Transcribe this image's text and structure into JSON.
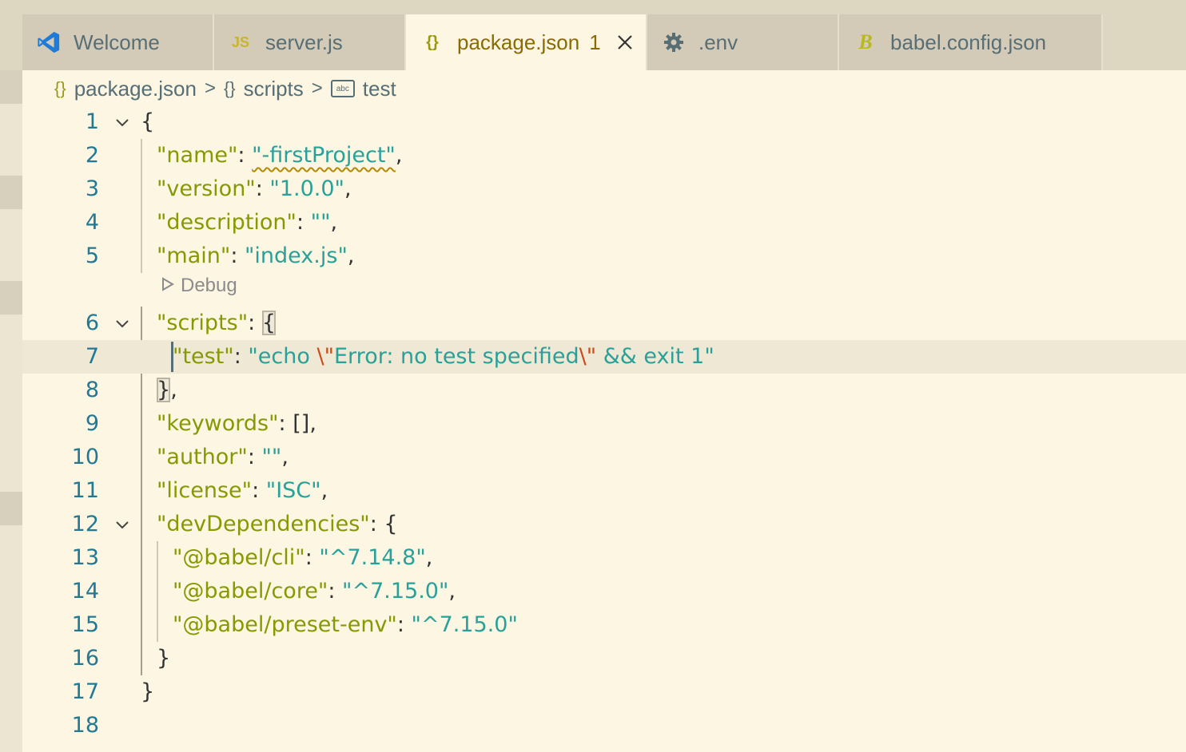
{
  "tabs": [
    {
      "label": "Welcome",
      "icon": "vscode-logo-icon",
      "active": false
    },
    {
      "label": "server.js",
      "icon": "js-file-icon",
      "icon_text": "JS",
      "active": false
    },
    {
      "label": "package.json",
      "icon": "json-braces-icon",
      "icon_text": "{}",
      "active": true,
      "problems": "1"
    },
    {
      "label": ".env",
      "icon": "gear-icon",
      "active": false
    },
    {
      "label": "babel.config.json",
      "icon": "babel-icon",
      "icon_text": "B",
      "active": false
    }
  ],
  "breadcrumb": {
    "file_icon": "{}",
    "file": "package.json",
    "sep": ">",
    "scope_icon": "{}",
    "scope": "scripts",
    "prop_icon": "abc",
    "prop": "test"
  },
  "codelens": {
    "label": "Debug"
  },
  "line_numbers": [
    "1",
    "2",
    "3",
    "4",
    "5",
    "6",
    "7",
    "8",
    "9",
    "10",
    "11",
    "12",
    "13",
    "14",
    "15",
    "16",
    "17",
    "18"
  ],
  "code": {
    "l1": {
      "brace": "{"
    },
    "l2": {
      "key": "\"name\"",
      "colon": ": ",
      "value": "\"-firstProject\"",
      "trail": ","
    },
    "l3": {
      "key": "\"version\"",
      "colon": ": ",
      "value": "\"1.0.0\"",
      "trail": ","
    },
    "l4": {
      "key": "\"description\"",
      "colon": ": ",
      "value": "\"\"",
      "trail": ","
    },
    "l5": {
      "key": "\"main\"",
      "colon": ": ",
      "value": "\"index.js\"",
      "trail": ","
    },
    "l6": {
      "key": "\"scripts\"",
      "colon": ": ",
      "brace": "{"
    },
    "l7": {
      "key": "\"test\"",
      "colon": ": ",
      "v1": "\"echo ",
      "e1": "\\\"",
      "v2": "Error: no test specified",
      "e2": "\\\"",
      "v3": " && exit 1\""
    },
    "l8": {
      "brace": "}",
      "trail": ","
    },
    "l9": {
      "key": "\"keywords\"",
      "colon": ": ",
      "value": "[]",
      "trail": ","
    },
    "l10": {
      "key": "\"author\"",
      "colon": ": ",
      "value": "\"\"",
      "trail": ","
    },
    "l11": {
      "key": "\"license\"",
      "colon": ": ",
      "value": "\"ISC\"",
      "trail": ","
    },
    "l12": {
      "key": "\"devDependencies\"",
      "colon": ": ",
      "brace": "{"
    },
    "l13": {
      "key": "\"@babel/cli\"",
      "colon": ": ",
      "value": "\"^7.14.8\"",
      "trail": ","
    },
    "l14": {
      "key": "\"@babel/core\"",
      "colon": ": ",
      "value": "\"^7.15.0\"",
      "trail": ","
    },
    "l15": {
      "key": "\"@babel/preset-env\"",
      "colon": ": ",
      "value": "\"^7.15.0\""
    },
    "l16": {
      "brace": "}"
    },
    "l17": {
      "brace": "}"
    }
  },
  "colors": {
    "editor_bg": "#fdf6e3",
    "key": "#859900",
    "string": "#2aa198",
    "escape": "#cb4b16",
    "line_number": "#237893",
    "tab_inactive": "#d3cbb7"
  }
}
